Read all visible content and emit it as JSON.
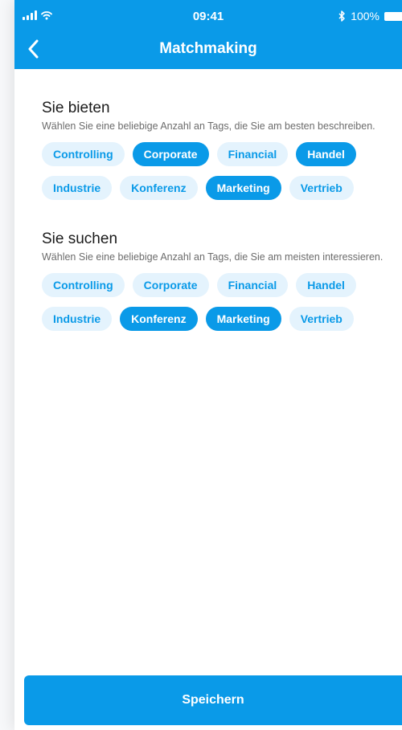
{
  "status_bar": {
    "time": "09:41",
    "battery": "100%"
  },
  "nav": {
    "title": "Matchmaking"
  },
  "offer": {
    "title": "Sie bieten",
    "subtitle": "Wählen Sie eine beliebige Anzahl an Tags, die Sie am besten beschreiben.",
    "rows": [
      [
        {
          "label": "Controlling",
          "selected": false
        },
        {
          "label": "Corporate",
          "selected": true
        },
        {
          "label": "Financial",
          "selected": false
        },
        {
          "label": "Handel",
          "selected": true
        }
      ],
      [
        {
          "label": "Industrie",
          "selected": false
        },
        {
          "label": "Konferenz",
          "selected": false
        },
        {
          "label": "Marketing",
          "selected": true
        },
        {
          "label": "Vertrieb",
          "selected": false
        }
      ]
    ]
  },
  "search": {
    "title": "Sie suchen",
    "subtitle": "Wählen Sie eine beliebige Anzahl an Tags, die Sie am meisten interessieren.",
    "rows": [
      [
        {
          "label": "Controlling",
          "selected": false
        },
        {
          "label": "Corporate",
          "selected": false
        },
        {
          "label": "Financial",
          "selected": false
        },
        {
          "label": "Handel",
          "selected": false
        }
      ],
      [
        {
          "label": "Industrie",
          "selected": false
        },
        {
          "label": "Konferenz",
          "selected": true
        },
        {
          "label": "Marketing",
          "selected": true
        },
        {
          "label": "Vertrieb",
          "selected": false
        }
      ]
    ]
  },
  "save_label": "Speichern",
  "colors": {
    "accent": "#0a9ae8",
    "tag_unselected_bg": "#e4f3fd",
    "tag_selected_text": "#ffffff"
  }
}
